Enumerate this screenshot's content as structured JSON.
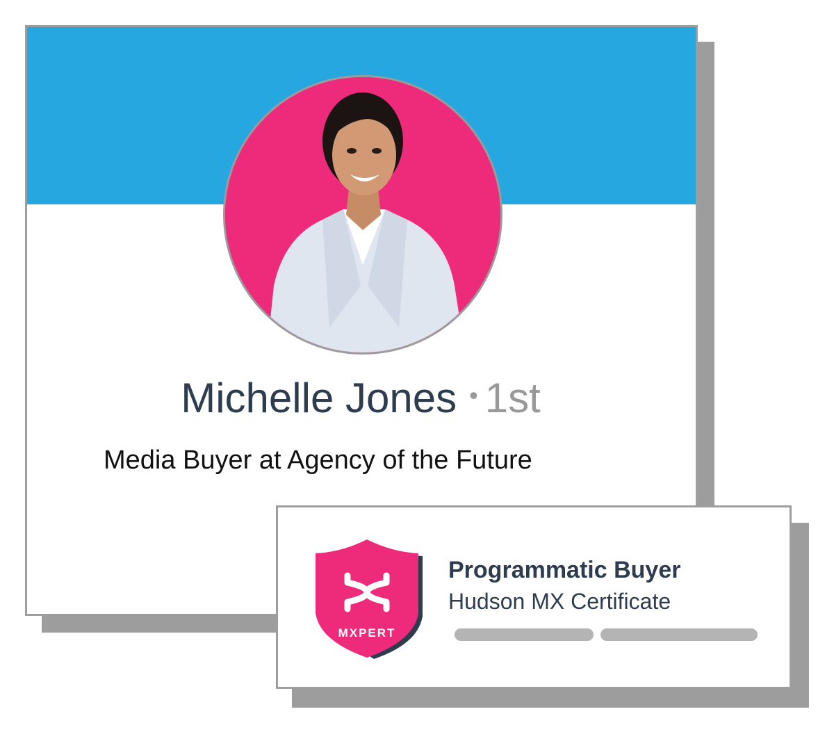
{
  "profile": {
    "name": "Michelle Jones",
    "separator": "•",
    "connection_degree": "1st",
    "headline": "Media Buyer at Agency of the Future",
    "colors": {
      "cover": "#27a7df",
      "avatar_background": "#ee2a7b",
      "name_text": "#2d3c4e"
    }
  },
  "certificate": {
    "title": "Programmatic Buyer",
    "subtitle": "Hudson MX Certificate",
    "badge": {
      "label": "MXPERT",
      "icon": "shield-icon",
      "color": "#ee2a7b"
    }
  }
}
